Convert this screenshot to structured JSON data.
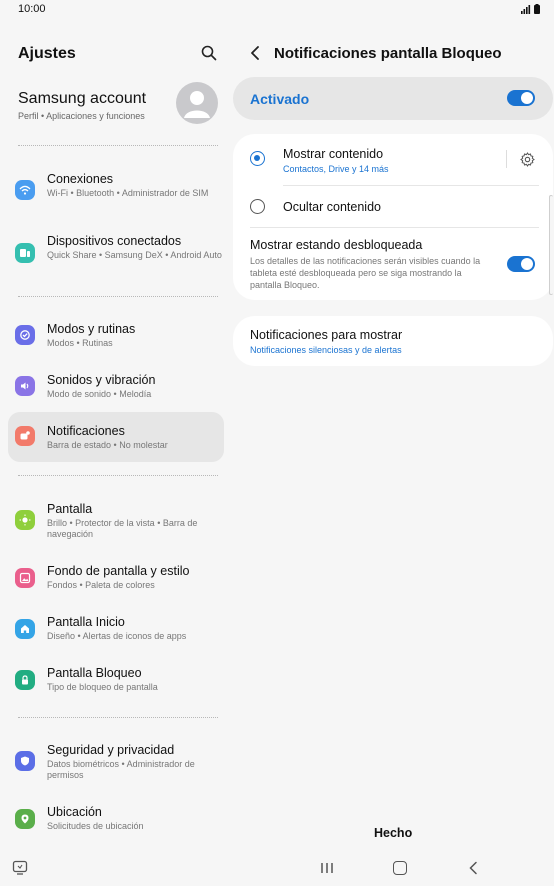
{
  "status": {
    "time": "10:00"
  },
  "left": {
    "title": "Ajustes",
    "account": {
      "name": "Samsung account",
      "sub": "Perfil • Aplicaciones y funciones"
    },
    "items": [
      {
        "title": "Conexiones",
        "sub": "Wi-Fi • Bluetooth • Administrador de SIM",
        "icon": "wifi-icon",
        "color": "#4a9df0"
      },
      {
        "title": "Dispositivos conectados",
        "sub": "Quick Share • Samsung DeX • Android Auto",
        "icon": "devices-icon",
        "color": "#35bfb0"
      },
      {
        "title": "Modos y rutinas",
        "sub": "Modos • Rutinas",
        "icon": "modes-icon",
        "color": "#6a6ee8"
      },
      {
        "title": "Sonidos y vibración",
        "sub": "Modo de sonido • Melodía",
        "icon": "sound-icon",
        "color": "#8a74e6"
      },
      {
        "title": "Notificaciones",
        "sub": "Barra de estado • No molestar",
        "icon": "notifications-icon",
        "color": "#f27a6a"
      },
      {
        "title": "Pantalla",
        "sub": "Brillo • Protector de la vista • Barra de navegación",
        "icon": "display-icon",
        "color": "#8fcf3c"
      },
      {
        "title": "Fondo de pantalla y estilo",
        "sub": "Fondos • Paleta de colores",
        "icon": "wallpaper-icon",
        "color": "#ea5f8c"
      },
      {
        "title": "Pantalla Inicio",
        "sub": "Diseño • Alertas de iconos de apps",
        "icon": "home-icon",
        "color": "#34a4e6"
      },
      {
        "title": "Pantalla Bloqueo",
        "sub": "Tipo de bloqueo de pantalla",
        "icon": "lock-icon",
        "color": "#22ad82"
      },
      {
        "title": "Seguridad y privacidad",
        "sub": "Datos biométricos • Administrador de permisos",
        "icon": "shield-icon",
        "color": "#5b6ee6"
      },
      {
        "title": "Ubicación",
        "sub": "Solicitudes de ubicación",
        "icon": "location-icon",
        "color": "#5aae4a"
      }
    ]
  },
  "right": {
    "title": "Notificaciones pantalla Bloqueo",
    "master_label": "Activado",
    "master_on": true,
    "show_content": {
      "title": "Mostrar contenido",
      "sub": "Contactos, Drive y 14 más",
      "selected": true
    },
    "hide_content": {
      "title": "Ocultar contenido",
      "selected": false
    },
    "show_unlocked": {
      "title": "Mostrar estando desbloqueada",
      "desc": "Los detalles de las notificaciones serán visibles cuando la tableta esté desbloqueada pero se siga mostrando la pantalla Bloqueo.",
      "on": true
    },
    "notif_to_show": {
      "title": "Notificaciones para mostrar",
      "sub": "Notificaciones silenciosas y de alertas"
    },
    "done_label": "Hecho"
  },
  "colors": {
    "accent": "#1a73d1",
    "background": "#f6f6f6",
    "card": "#ffffff"
  }
}
